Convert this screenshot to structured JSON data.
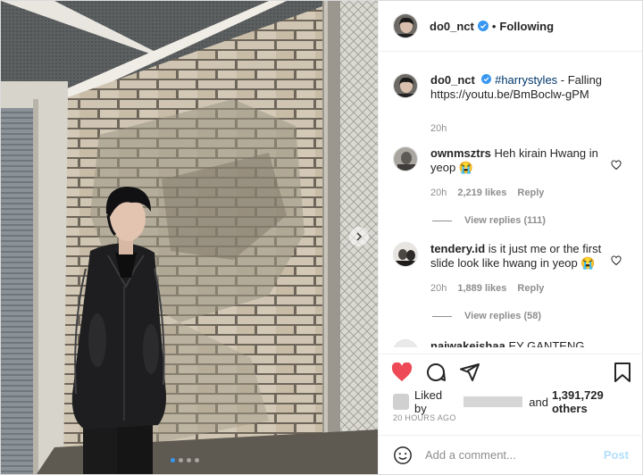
{
  "post": {
    "username": "do0_nct",
    "follow_label": "Following",
    "separator": "•",
    "caption": {
      "username": "do0_nct",
      "hashtag": "#harrystyles",
      "text": "- Falling",
      "link": "https://youtu.be/BmBoclw-gPM",
      "time": "20h"
    }
  },
  "comments": [
    {
      "username": "ownmsztrs",
      "text": "Heh kirain Hwang in yeop",
      "emoji": "😭",
      "time": "20h",
      "likes": "2,219 likes",
      "reply_label": "Reply",
      "view_replies": "View replies (111)"
    },
    {
      "username": "tendery.id",
      "text": "is it just me or the first slide look like hwang in yeop",
      "emoji": "😭",
      "time": "20h",
      "likes": "1,889 likes",
      "reply_label": "Reply",
      "view_replies": "View replies (58)"
    },
    {
      "username": "naiwakeishaa",
      "text": "EY GANTENG BGT"
    }
  ],
  "engagement": {
    "liked_by_prefix": "Liked by",
    "and_label": "and",
    "others": "1,391,729 others",
    "timestamp": "20 HOURS AGO",
    "like_color": "#ed4956"
  },
  "comment_box": {
    "placeholder": "Add a comment...",
    "post_label": "Post"
  },
  "carousel": {
    "slide_count": 4,
    "active_index": 0
  },
  "colors": {
    "verified": "#3897f0",
    "link": "#00376b",
    "post_button": "#b2dffc"
  }
}
